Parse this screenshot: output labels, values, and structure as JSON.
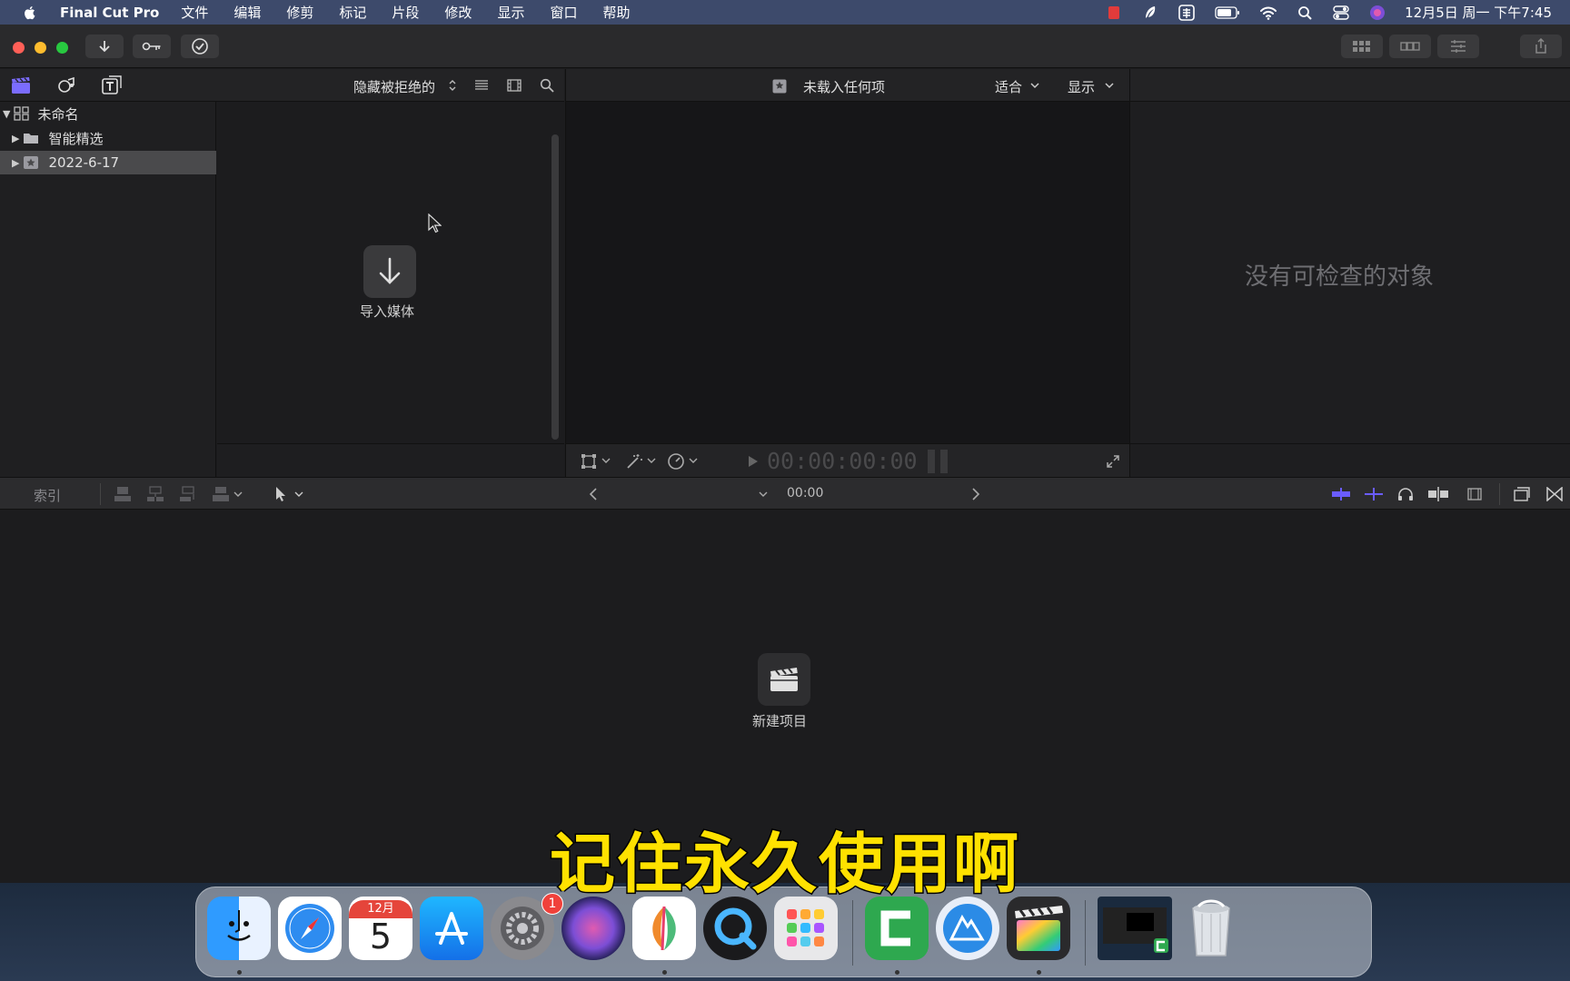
{
  "menubar": {
    "app_name": "Final Cut Pro",
    "menus": [
      "文件",
      "编辑",
      "修剪",
      "标记",
      "片段",
      "修改",
      "显示",
      "窗口",
      "帮助"
    ],
    "datetime": "12月5日 周一 下午7:45"
  },
  "browser": {
    "filter_label": "隐藏被拒绝的",
    "library_name": "未命名",
    "items": [
      {
        "label": "智能精选"
      },
      {
        "label": "2022-6-17"
      }
    ],
    "import_label": "导入媒体"
  },
  "viewer": {
    "title": "未载入任何项",
    "fit_label": "适合",
    "display_label": "显示",
    "timecode": "00:00:00:00"
  },
  "inspector": {
    "empty_text": "没有可检查的对象"
  },
  "timeline_toolbar": {
    "index_label": "索引",
    "timecode": "00:00"
  },
  "timeline": {
    "new_project_label": "新建项目"
  },
  "subtitle": "记住永久使用啊",
  "dock": {
    "calendar_month": "12月",
    "calendar_day": "5",
    "settings_badge": "1",
    "apps": [
      "finder-icon",
      "safari-icon",
      "calendar-icon",
      "app-store-icon",
      "system-preferences-icon",
      "siri-icon",
      "paw-icon",
      "quicktime-icon",
      "launchpad-icon",
      "camtasia-icon",
      "creative-cloud-icon",
      "final-cut-pro-icon",
      "screenshot-thumb-icon",
      "trash-icon"
    ]
  },
  "colors": {
    "menubar": "#3d4a6b",
    "accent_purple": "#7b6cff",
    "subtitle": "#ffe100"
  }
}
